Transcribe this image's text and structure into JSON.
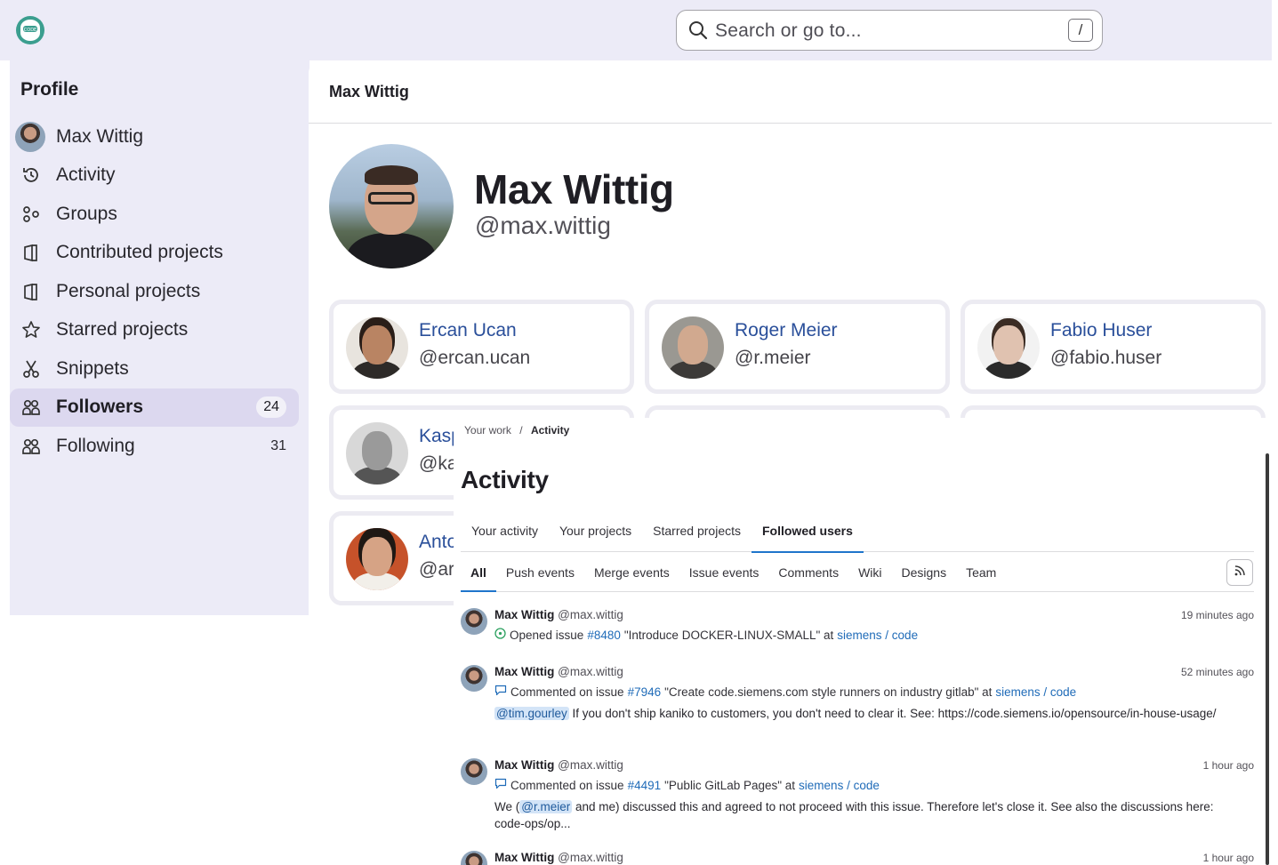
{
  "search": {
    "placeholder": "Search or go to...",
    "shortcut": "/"
  },
  "sidebar": {
    "title": "Profile",
    "items": [
      {
        "label": "Max Wittig",
        "icon": "avatar"
      },
      {
        "label": "Activity",
        "icon": "history-icon"
      },
      {
        "label": "Groups",
        "icon": "groups-icon"
      },
      {
        "label": "Contributed projects",
        "icon": "project-icon"
      },
      {
        "label": "Personal projects",
        "icon": "project-icon"
      },
      {
        "label": "Starred projects",
        "icon": "star-icon"
      },
      {
        "label": "Snippets",
        "icon": "scissors-icon"
      },
      {
        "label": "Followers",
        "icon": "users-icon",
        "count": "24",
        "active": true
      },
      {
        "label": "Following",
        "icon": "users-icon",
        "count": "31"
      }
    ]
  },
  "header": {
    "title": "Max Wittig"
  },
  "profile": {
    "name": "Max Wittig",
    "handle": "@max.wittig"
  },
  "followers": [
    {
      "name": "Ercan Ucan",
      "handle": "@ercan.ucan"
    },
    {
      "name": "Roger Meier",
      "handle": "@r.meier"
    },
    {
      "name": "Fabio Huser",
      "handle": "@fabio.huser"
    },
    {
      "name": "Kasp",
      "handle": "@ka"
    },
    {
      "name": "Anto",
      "handle": "@ar"
    }
  ],
  "activity": {
    "breadcrumb": {
      "parent": "Your work",
      "sep": "/",
      "current": "Activity"
    },
    "title": "Activity",
    "tabs": [
      "Your activity",
      "Your projects",
      "Starred projects",
      "Followed users"
    ],
    "active_tab": "Followed users",
    "filters": [
      "All",
      "Push events",
      "Merge events",
      "Issue events",
      "Comments",
      "Wiki",
      "Designs",
      "Team"
    ],
    "active_filter": "All",
    "events": [
      {
        "author": "Max Wittig",
        "handle": "@max.wittig",
        "time": "19 minutes ago",
        "action": "Opened issue",
        "issue": "#8480",
        "subject": "\"Introduce DOCKER-LINUX-SMALL\" at",
        "project": "siemens / code",
        "icon": "issue-open-icon"
      },
      {
        "author": "Max Wittig",
        "handle": "@max.wittig",
        "time": "52 minutes ago",
        "action": "Commented on issue",
        "issue": "#7946",
        "subject": "\"Create code.siemens.com style runners on industry gitlab\" at",
        "project": "siemens / code",
        "icon": "comment-icon",
        "mention": "@tim.gourley",
        "body": " If you don't ship kaniko to customers, you don't need to clear it. See: https://code.siemens.io/opensource/in-house-usage/"
      },
      {
        "author": "Max Wittig",
        "handle": "@max.wittig",
        "time": "1 hour ago",
        "action": "Commented on issue",
        "issue": "#4491",
        "subject": "\"Public GitLab Pages\" at",
        "project": "siemens / code",
        "icon": "comment-icon",
        "body_pre": "We (",
        "mention": "@r.meier",
        "body": " and me) discussed this and agreed to not proceed with this issue. Therefore let's close it. See also the discussions here: code-ops/op..."
      },
      {
        "author": "Max Wittig",
        "handle": "@max.wittig",
        "time": "1 hour ago"
      }
    ]
  },
  "colors": {
    "sidebar_bg": "#ecebf7",
    "active_nav": "#dcd8ef",
    "link": "#1f6bb8",
    "accent": "#1f75cb"
  }
}
